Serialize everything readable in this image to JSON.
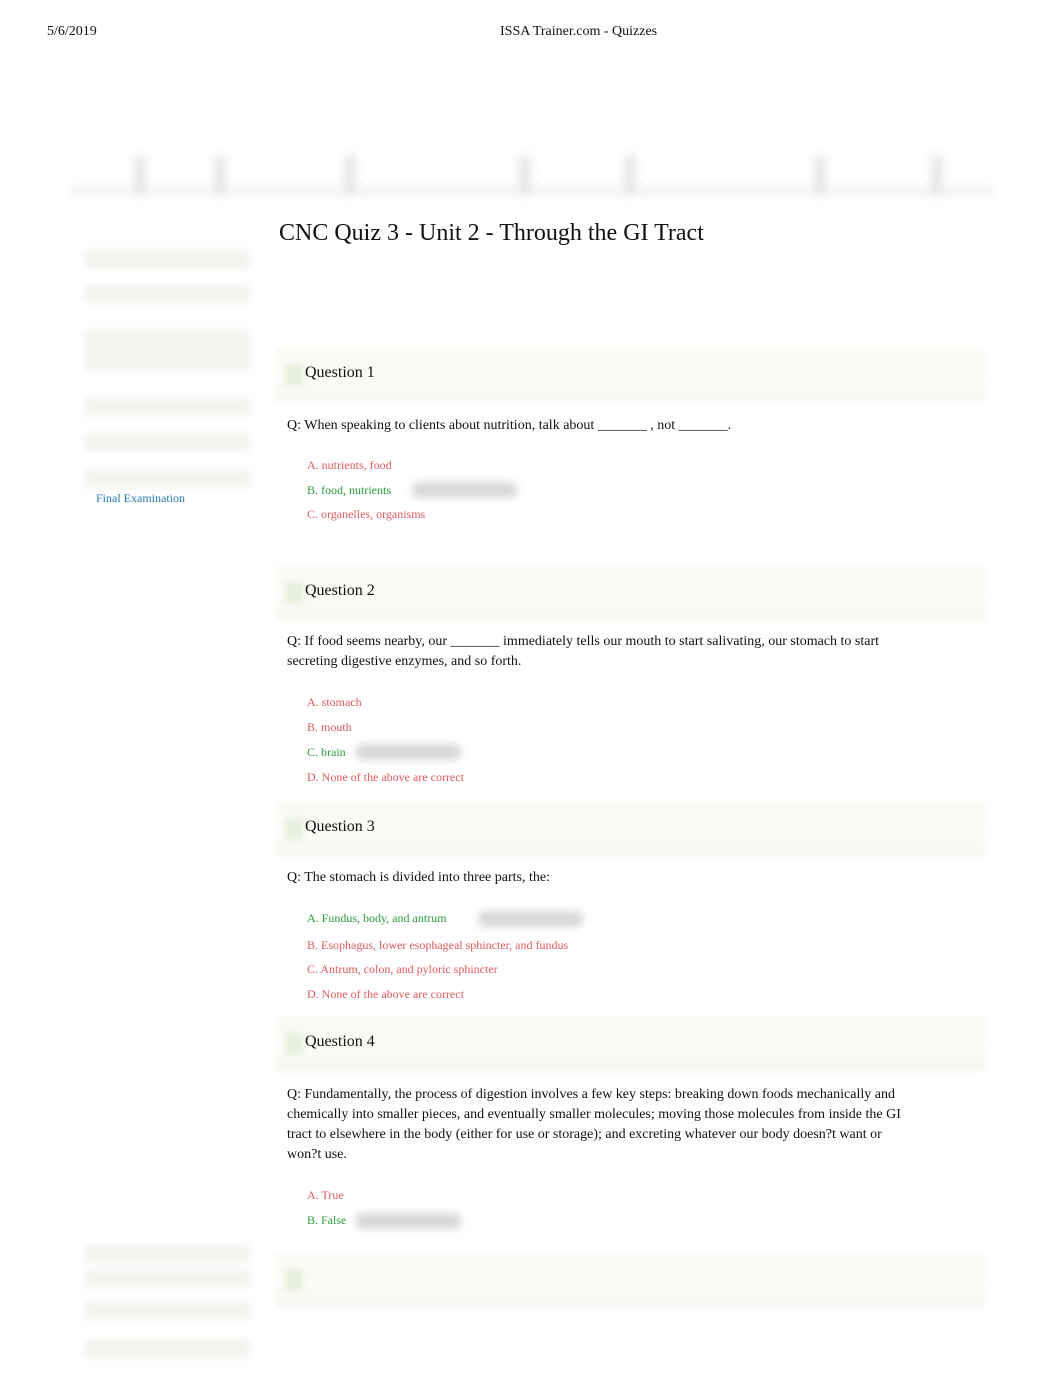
{
  "header": {
    "date": "5/6/2019",
    "title": "ISSA Trainer.com - Quizzes"
  },
  "page_title": "CNC Quiz 3 - Unit 2 - Through the GI Tract",
  "sidebar": {
    "link": "Final Examination"
  },
  "colors": {
    "incorrect": "#e05a5e",
    "correct": "#2a9d3a",
    "link": "#2a7ab9"
  },
  "questions": [
    {
      "label": "Question 1",
      "text": "Q:  When speaking to clients about nutrition, talk about _______ , not _______.",
      "options": [
        {
          "text": "A. nutrients, food",
          "status": "incorrect"
        },
        {
          "text": "B. food, nutrients",
          "status": "correct"
        },
        {
          "text": "C. organelles, organisms",
          "status": "incorrect"
        }
      ]
    },
    {
      "label": "Question 2",
      "text": "Q:  If food seems nearby, our _______ immediately tells our mouth to start salivating, our stomach to start secreting digestive enzymes, and so forth.",
      "options": [
        {
          "text": "A. stomach",
          "status": "incorrect"
        },
        {
          "text": "B. mouth",
          "status": "incorrect"
        },
        {
          "text": "C. brain",
          "status": "correct"
        },
        {
          "text": "D. None of the above are correct",
          "status": "incorrect"
        }
      ]
    },
    {
      "label": "Question 3",
      "text": "Q:  The stomach is divided into three parts, the:",
      "options": [
        {
          "text": "A. Fundus, body, and antrum",
          "status": "correct"
        },
        {
          "text": "B. Esophagus, lower esophageal sphincter, and fundus",
          "status": "incorrect"
        },
        {
          "text": "C. Antrum, colon, and pyloric sphincter",
          "status": "incorrect"
        },
        {
          "text": "D. None of the above are correct",
          "status": "incorrect"
        }
      ]
    },
    {
      "label": "Question 4",
      "text": "Q:  Fundamentally, the process of digestion involves a few key steps: breaking down foods mechanically and chemically into smaller pieces, and eventually smaller molecules; moving those molecules from inside the GI tract to elsewhere in the body (either for use or storage); and excreting whatever our body doesn?t want or won?t use.",
      "options": [
        {
          "text": "A. True",
          "status": "incorrect"
        },
        {
          "text": "B. False",
          "status": "correct"
        }
      ]
    }
  ]
}
